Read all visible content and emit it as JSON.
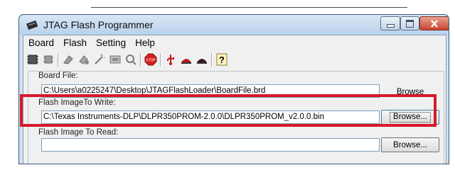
{
  "window": {
    "title": "JTAG Flash Programmer"
  },
  "menu": {
    "items": [
      "Board",
      "Flash",
      "Setting",
      "Help"
    ]
  },
  "toolbar": {
    "icons": [
      "chip-icon",
      "chip-connect-icon",
      "erase-icon",
      "program-icon",
      "wand-icon",
      "memory-icon",
      "verify-icon",
      "stop-icon",
      "usb-icon",
      "device-red-icon",
      "device-dark-icon",
      "help-icon"
    ]
  },
  "board_file": {
    "label": "Board File:",
    "value": "C:\\Users\\a0225247\\Desktop\\JTAGFlashLoader\\BoardFile.brd",
    "button": "Browse"
  },
  "flash_write": {
    "label": "Flash ImageTo Write:",
    "value": "C:\\Texas Instruments-DLP\\DLPR350PROM-2.0.0\\DLPR350PROM_v2.0.0.bin",
    "button": "Browse..."
  },
  "flash_read": {
    "label": "Flash Image To Read:",
    "value": "",
    "button": "Browse..."
  },
  "colors": {
    "highlight": "#d8182a",
    "titlebar": "#c8dcf2",
    "close_button": "#c7432e"
  }
}
